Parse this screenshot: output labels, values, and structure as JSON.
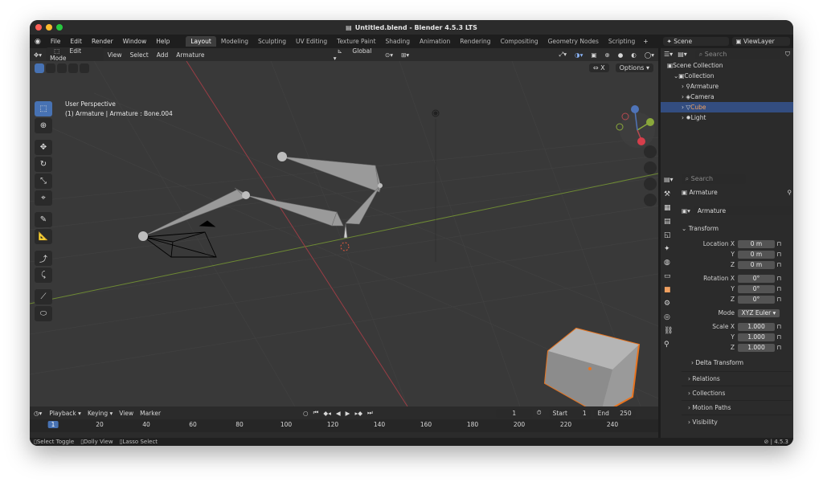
{
  "window": {
    "title": "Untitled.blend - Blender 4.5.3 LTS"
  },
  "menu": [
    "File",
    "Edit",
    "Render",
    "Window",
    "Help"
  ],
  "workspaces": [
    "Layout",
    "Modeling",
    "Sculpting",
    "UV Editing",
    "Texture Paint",
    "Shading",
    "Animation",
    "Rendering",
    "Compositing",
    "Geometry Nodes",
    "Scripting"
  ],
  "scene": {
    "scene_name": "Scene",
    "view_layer": "ViewLayer"
  },
  "viewport_header": {
    "mode": "Edit Mode",
    "view": "View",
    "select": "Select",
    "add": "Add",
    "armature": "Armature",
    "orientation": "Global",
    "options": "Options",
    "x_label": "X"
  },
  "viewport": {
    "perspective": "User Perspective",
    "context": "(1) Armature | Armature : Bone.004"
  },
  "outliner": {
    "search_placeholder": "Search",
    "root": "Scene Collection",
    "collection": "Collection",
    "items": [
      {
        "label": "Armature"
      },
      {
        "label": "Camera"
      },
      {
        "label": "Cube"
      },
      {
        "label": "Light"
      }
    ]
  },
  "properties": {
    "search_placeholder": "Search",
    "object_name": "Armature",
    "data_name": "Armature",
    "transform_label": "Transform",
    "location": {
      "label": "Location X",
      "x": "0 m",
      "y_label": "Y",
      "y": "0 m",
      "z_label": "Z",
      "z": "0 m"
    },
    "rotation": {
      "label": "Rotation X",
      "x": "0°",
      "y_label": "Y",
      "y": "0°",
      "z_label": "Z",
      "z": "0°"
    },
    "mode": {
      "label": "Mode",
      "value": "XYZ Euler"
    },
    "scale": {
      "label": "Scale X",
      "x": "1.000",
      "y_label": "Y",
      "y": "1.000",
      "z_label": "Z",
      "z": "1.000"
    },
    "delta": "Delta Transform",
    "sections": [
      "Relations",
      "Collections",
      "Motion Paths",
      "Visibility"
    ]
  },
  "timeline": {
    "playback": "Playback",
    "keying": "Keying",
    "view": "View",
    "marker": "Marker",
    "current_frame": "1",
    "start_label": "Start",
    "start": "1",
    "end_label": "End",
    "end": "250",
    "ticks": [
      "1",
      "20",
      "40",
      "60",
      "80",
      "100",
      "120",
      "140",
      "160",
      "180",
      "200",
      "220",
      "240"
    ]
  },
  "status": {
    "select": "Select Toggle",
    "dolly": "Dolly View",
    "lasso": "Lasso Select",
    "version": "4.5.3"
  },
  "colors": {
    "accent": "#4772b3",
    "cube_outline": "#e8741f",
    "x_axis": "#b54950",
    "y_axis": "#8aa83b"
  }
}
